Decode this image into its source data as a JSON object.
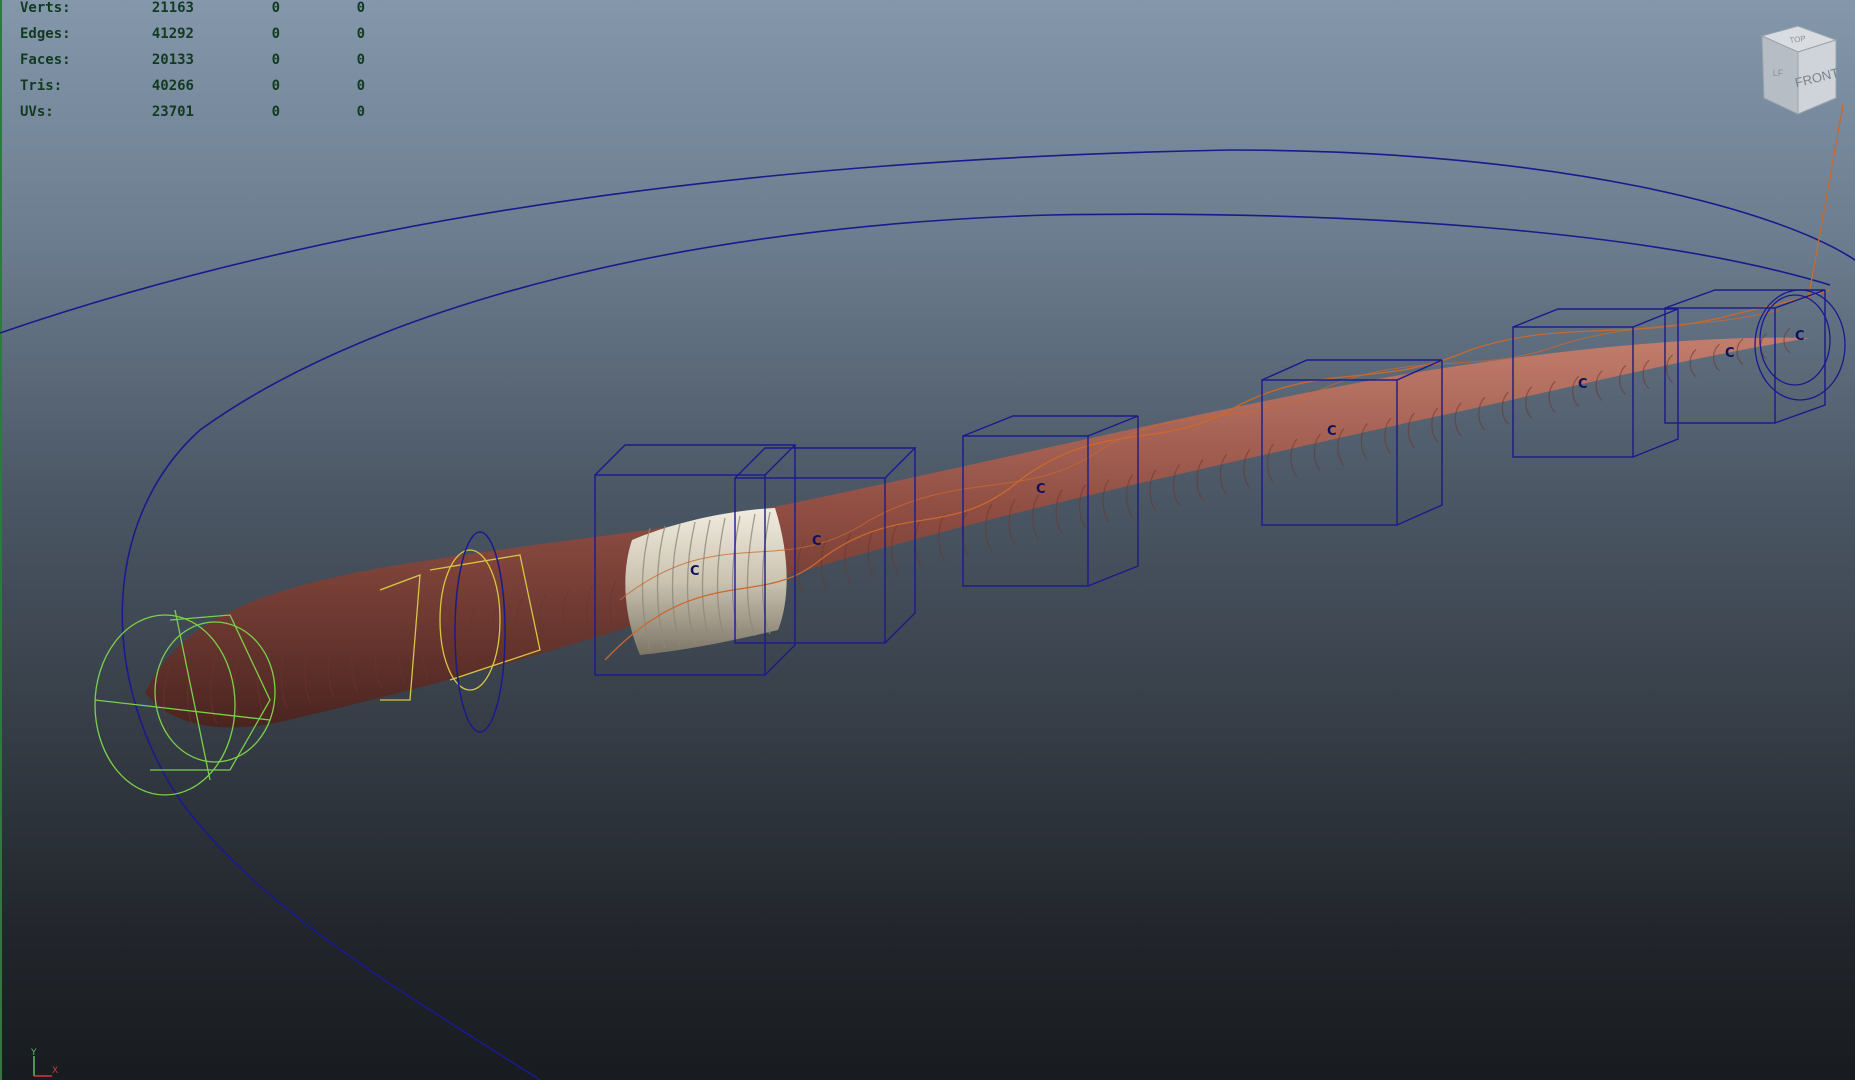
{
  "hud": {
    "rows": [
      {
        "label": "Verts:",
        "v1": "21163",
        "v2": "0",
        "v3": "0"
      },
      {
        "label": "Edges:",
        "v1": "41292",
        "v2": "0",
        "v3": "0"
      },
      {
        "label": "Faces:",
        "v1": "20133",
        "v2": "0",
        "v3": "0"
      },
      {
        "label": "Tris:",
        "v1": "40266",
        "v2": "0",
        "v3": "0"
      },
      {
        "label": "UVs:",
        "v1": "23701",
        "v2": "0",
        "v3": "0"
      }
    ]
  },
  "viewcube": {
    "front": "FRONT",
    "top": "TOP",
    "left": "LF"
  },
  "axis": {
    "y": "Y",
    "x": "X"
  },
  "controls": {
    "label": "C"
  },
  "colors": {
    "body": "#9a5a4e",
    "clitellum": "#d8d2c2",
    "nurbs_curve": "#1a1a8c",
    "ik_curve": "#c8692e",
    "head_control": "#7bd04a",
    "yellow_control": "#d7c642"
  }
}
